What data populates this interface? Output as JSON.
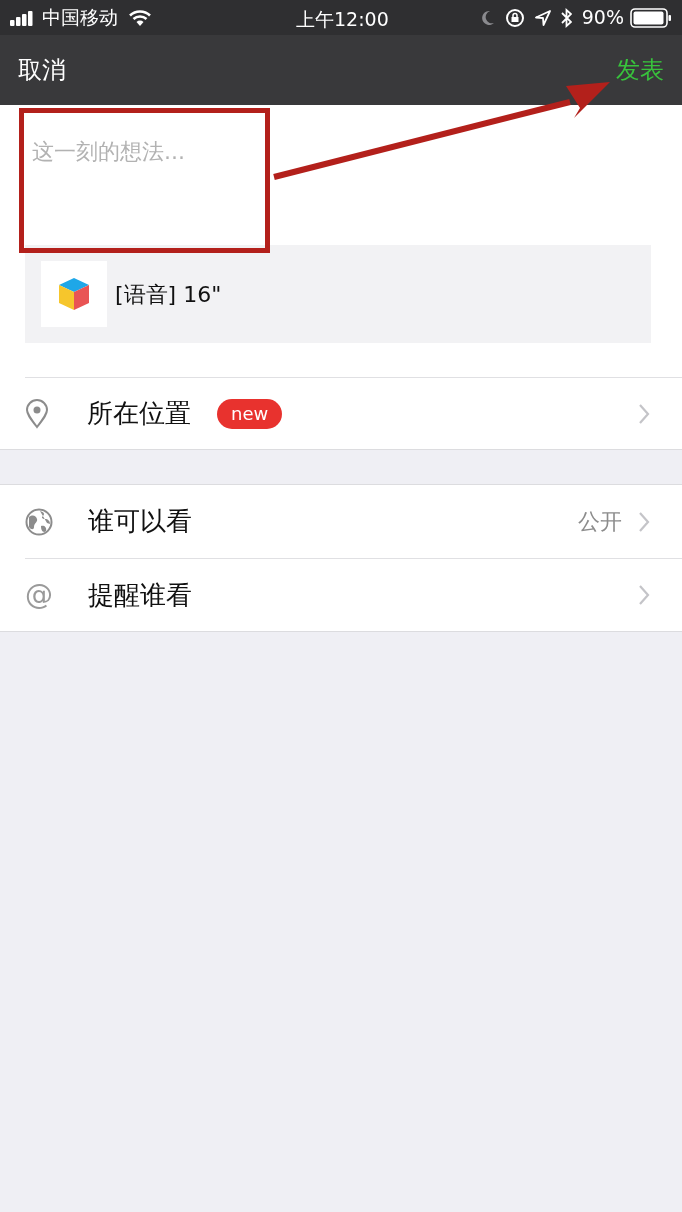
{
  "status_bar": {
    "carrier": "中国移动",
    "time": "上午12:00",
    "battery_text": "90%"
  },
  "nav": {
    "cancel": "取消",
    "publish": "发表"
  },
  "compose": {
    "placeholder": "这一刻的想法..."
  },
  "attachment": {
    "label": "[语音] 16\""
  },
  "location_row": {
    "label": "所在位置",
    "badge": "new"
  },
  "rows": [
    {
      "kind": "globe",
      "label": "谁可以看",
      "value": "公开"
    },
    {
      "kind": "mention",
      "icon_glyph": "@",
      "label": "提醒谁看"
    }
  ]
}
